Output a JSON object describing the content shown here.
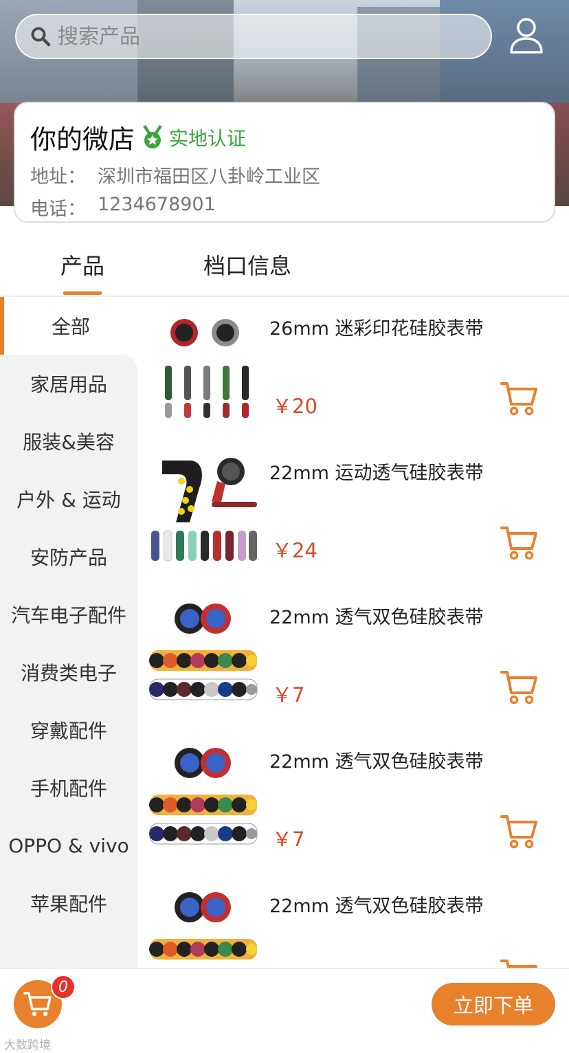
{
  "header": {
    "search_placeholder": "搜索产品",
    "user_icon": "user-icon"
  },
  "shop": {
    "name": "你的微店",
    "verified_label": "实地认证",
    "address_label": "地址：",
    "address": "深圳市福田区八卦岭工业区",
    "phone_label": "电话：",
    "phone": "1234678901"
  },
  "tabs": [
    {
      "label": "产品",
      "active": true
    },
    {
      "label": "档口信息",
      "active": false
    }
  ],
  "categories": [
    {
      "label": "全部",
      "active": true
    },
    {
      "label": "家居用品"
    },
    {
      "label": "服装&美容"
    },
    {
      "label": "户外 & 运动"
    },
    {
      "label": "安防产品"
    },
    {
      "label": "汽车电子配件"
    },
    {
      "label": "消费类电子"
    },
    {
      "label": "穿戴配件"
    },
    {
      "label": "手机配件"
    },
    {
      "label": "OPPO & vivo"
    },
    {
      "label": "苹果配件"
    }
  ],
  "products": [
    {
      "name": "26mm 迷彩印花硅胶表带",
      "price": "￥20"
    },
    {
      "name": "22mm 运动透气硅胶表带",
      "price": "￥24"
    },
    {
      "name": "22mm 透气双色硅胶表带",
      "price": "￥7"
    },
    {
      "name": "22mm 透气双色硅胶表带",
      "price": "￥7"
    },
    {
      "name": "22mm 透气双色硅胶表带",
      "price": ""
    }
  ],
  "bottom": {
    "cart_count": "0",
    "order_button": "立即下单",
    "watermark": "大数跨境"
  },
  "colors": {
    "accent": "#e8812c",
    "price": "#d94a2b",
    "verified": "#3aa53a",
    "badge": "#e8312c"
  }
}
